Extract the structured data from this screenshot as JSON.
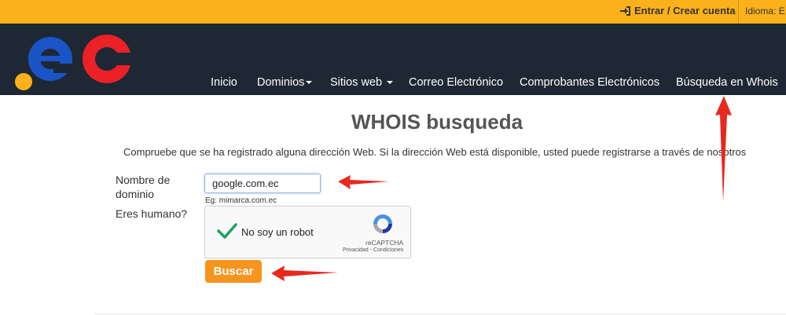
{
  "topbar": {
    "login_label": "Entrar / Crear cuenta",
    "language_label": "Idioma:",
    "language_value": "E"
  },
  "logo": {
    "text": ".ec"
  },
  "nav": {
    "items": [
      {
        "label": "Inicio",
        "dropdown": false
      },
      {
        "label": "Dominios",
        "dropdown": true
      },
      {
        "label": "Sitios web",
        "dropdown": true
      },
      {
        "label": "Correo Electrónico",
        "dropdown": false
      },
      {
        "label": "Comprobantes Electrónicos",
        "dropdown": false
      },
      {
        "label": "Búsqueda en Whois",
        "dropdown": false
      }
    ]
  },
  "main": {
    "title": "WHOIS busqueda",
    "description": "Compruebe que se ha registrado alguna dirección Web. Si la dirección Web está disponible, usted puede registrarse a través de nosotros",
    "domain_label_line1": "Nombre de",
    "domain_label_line2": "dominio",
    "domain_value": "google.com.ec",
    "domain_example": "Eg: mimarca.com.ec",
    "human_label": "Eres humano?",
    "captcha": {
      "text": "No soy un robot",
      "brand": "reCAPTCHA",
      "links": "Privacidad - Condiciones"
    },
    "search_button": "Buscar"
  },
  "colors": {
    "topbar": "#fbb21a",
    "nav_bg": "#1e2734",
    "logo_blue": "#1a55c8",
    "logo_red": "#ec2027",
    "logo_dot": "#fbb21a",
    "button": "#f7941d",
    "annotation_arrow": "#e8281e"
  }
}
